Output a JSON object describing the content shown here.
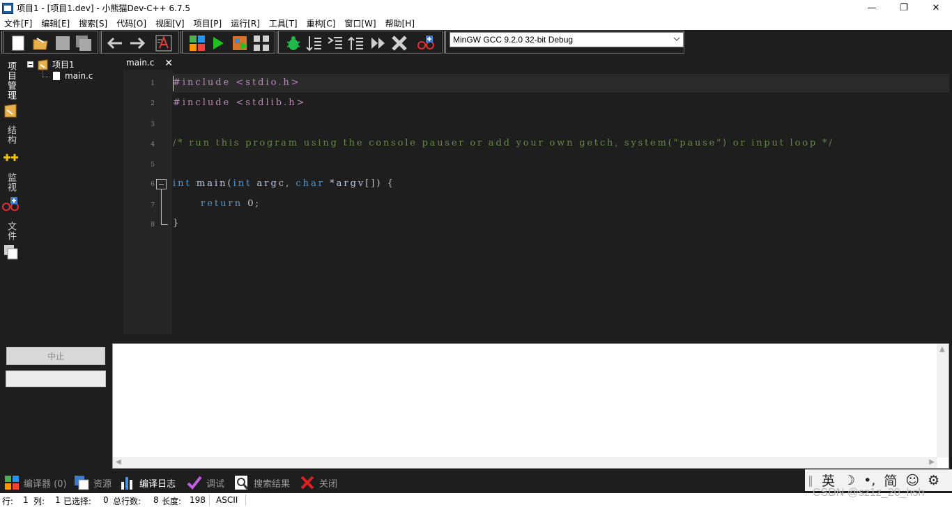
{
  "window": {
    "title": "项目1 - [项目1.dev] - 小熊猫Dev-C++ 6.7.5",
    "minimize": "—",
    "maximize": "❐",
    "close": "✕"
  },
  "menu": [
    "文件[F]",
    "编辑[E]",
    "搜索[S]",
    "代码[O]",
    "视图[V]",
    "项目[P]",
    "运行[R]",
    "工具[T]",
    "重构[C]",
    "窗口[W]",
    "帮助[H]"
  ],
  "toolbar": {
    "compiler": "MinGW GCC 9.2.0 32-bit Debug"
  },
  "left_tabs": {
    "project": "项目管理",
    "structure": "结构",
    "watch": "监视",
    "files": "文件"
  },
  "tree": {
    "project": "项目1",
    "file": "main.c"
  },
  "editor": {
    "tab": "main.c",
    "line_numbers": [
      "1",
      "2",
      "3",
      "4",
      "5",
      "6",
      "7",
      "8"
    ],
    "lines": {
      "l1": "#include <stdio.h>",
      "l2": "#include <stdlib.h>",
      "l4": "/* run this program using the console pauser or add your own getch, system(\"pause\") or input loop */",
      "l6_kw1": "int",
      "l6_id1": "main(",
      "l6_kw2": "int",
      "l6_id2": "argc,",
      "l6_kw3": "char",
      "l6_id3": "*argv[]) {",
      "l7_kw": "return",
      "l7_val": "0;",
      "l8": "}"
    }
  },
  "bottom": {
    "abort_button": "中止",
    "tabs": [
      "编译器 (0)",
      "资源",
      "编译日志",
      "调试",
      "搜索结果",
      "关闭"
    ]
  },
  "ime": {
    "lang": "英",
    "mode": "☽",
    "punct": "•,",
    "script": "简",
    "emoji": "☺",
    "settings": "⚙"
  },
  "status": {
    "row_label": "行:",
    "row_value": "1",
    "col_label": "列:",
    "col_value": "1",
    "sel_label": "已选择:",
    "sel_value": "0",
    "total_label": "总行数:",
    "total_value": "8",
    "len_label": "长度:",
    "len_value": "198",
    "encoding": "ASCII"
  },
  "watermark": "CSDN @sz1z_20_hsh",
  "colors": {
    "preprocessor": "#b98bb6",
    "comment": "#6a8a4a",
    "keyword": "#5b97c7"
  }
}
